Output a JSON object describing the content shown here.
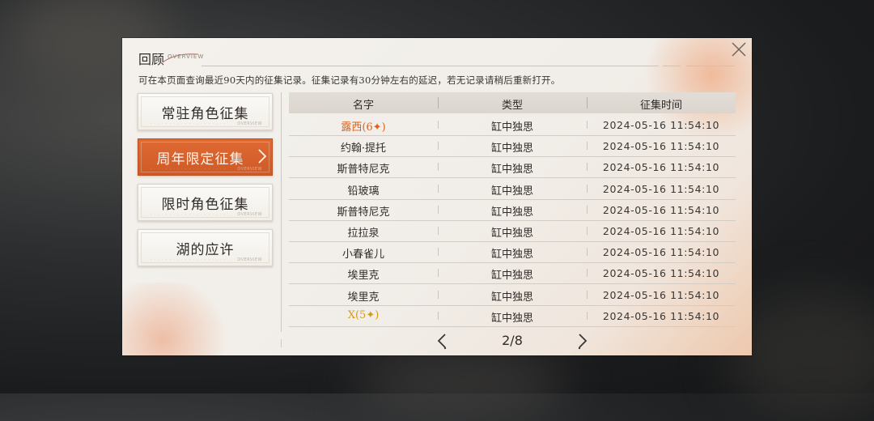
{
  "header": {
    "title": "回顾",
    "subtitle": "OVERVIEW"
  },
  "notice": "可在本页面查询最近90天内的征集记录。征集记录有30分钟左右的延迟，若无记录请稍后重新打开。",
  "sidebar": {
    "items": [
      {
        "label": "常驻角色征集",
        "active": false,
        "tag": "OVERVIEW"
      },
      {
        "label": "周年限定征集",
        "active": true,
        "tag": "OVERVIEW"
      },
      {
        "label": "限时角色征集",
        "active": false,
        "tag": "OVERVIEW"
      },
      {
        "label": "湖的应许",
        "active": false,
        "tag": "OVERVIEW"
      }
    ]
  },
  "table": {
    "headers": {
      "name": "名字",
      "type": "类型",
      "time": "征集时间"
    },
    "rows": [
      {
        "name": "露西(6✦)",
        "type": "缸中独思",
        "time": "2024-05-16 11:54:10",
        "color": "#d8641f"
      },
      {
        "name": "约翰·提托",
        "type": "缸中独思",
        "time": "2024-05-16 11:54:10",
        "color": "#2f2b28"
      },
      {
        "name": "斯普特尼克",
        "type": "缸中独思",
        "time": "2024-05-16 11:54:10",
        "color": "#2f2b28"
      },
      {
        "name": "铅玻璃",
        "type": "缸中独思",
        "time": "2024-05-16 11:54:10",
        "color": "#2f2b28"
      },
      {
        "name": "斯普特尼克",
        "type": "缸中独思",
        "time": "2024-05-16 11:54:10",
        "color": "#2f2b28"
      },
      {
        "name": "拉拉泉",
        "type": "缸中独思",
        "time": "2024-05-16 11:54:10",
        "color": "#2f2b28"
      },
      {
        "name": "小春雀儿",
        "type": "缸中独思",
        "time": "2024-05-16 11:54:10",
        "color": "#2f2b28"
      },
      {
        "name": "埃里克",
        "type": "缸中独思",
        "time": "2024-05-16 11:54:10",
        "color": "#2f2b28"
      },
      {
        "name": "埃里克",
        "type": "缸中独思",
        "time": "2024-05-16 11:54:10",
        "color": "#2f2b28"
      },
      {
        "name": "X(5✦)",
        "type": "缸中独思",
        "time": "2024-05-16 11:54:10",
        "color": "#d39a1c"
      }
    ]
  },
  "pager": {
    "text": "2/8"
  },
  "icons": {
    "close": "close-icon",
    "prev": "chevron-left-icon",
    "next": "chevron-right-icon",
    "active_arrow": "chevron-right-icon"
  },
  "colors": {
    "accent": "#d8602a",
    "six_star": "#d8641f",
    "five_star": "#d39a1c"
  }
}
